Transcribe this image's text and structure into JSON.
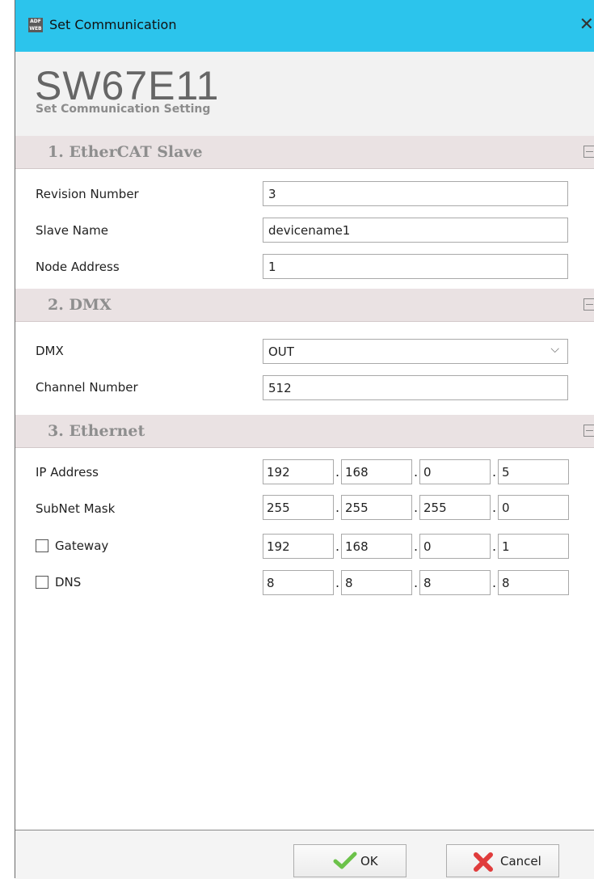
{
  "window": {
    "title": "Set Communication",
    "close_glyph": "✕",
    "icon_text": "ADF WEB"
  },
  "header": {
    "model": "SW67E11",
    "subtitle": "Set Communication Setting"
  },
  "sections": [
    {
      "title": "1. EtherCAT Slave"
    },
    {
      "title": "2. DMX"
    },
    {
      "title": "3. Ethernet"
    }
  ],
  "ethercat": {
    "revision_label": "Revision Number",
    "revision_value": "3",
    "slave_name_label": "Slave Name",
    "slave_name_value": "devicename1",
    "node_address_label": "Node Address",
    "node_address_value": "1"
  },
  "dmx": {
    "dmx_label": "DMX",
    "dmx_selected": "OUT",
    "channel_label": "Channel Number",
    "channel_value": "512"
  },
  "ethernet": {
    "ip_label": "IP Address",
    "ip": [
      "192",
      "168",
      "0",
      "5"
    ],
    "subnet_label": "SubNet Mask",
    "subnet": [
      "255",
      "255",
      "255",
      "0"
    ],
    "gateway_label": "Gateway",
    "gateway_checked": false,
    "gateway": [
      "192",
      "168",
      "0",
      "1"
    ],
    "dns_label": "DNS",
    "dns_checked": false,
    "dns": [
      "8",
      "8",
      "8",
      "8"
    ],
    "separator": "."
  },
  "footer": {
    "ok_label": "OK",
    "cancel_label": "Cancel"
  },
  "icons": {
    "ok": "check-icon",
    "cancel": "red-x-icon",
    "collapse": "collapse-minus-icon"
  },
  "colors": {
    "titlebar": "#2cc4ec",
    "section_bg": "#eae2e3",
    "ok_green": "#6cc24a",
    "cancel_red": "#e03c3c"
  }
}
